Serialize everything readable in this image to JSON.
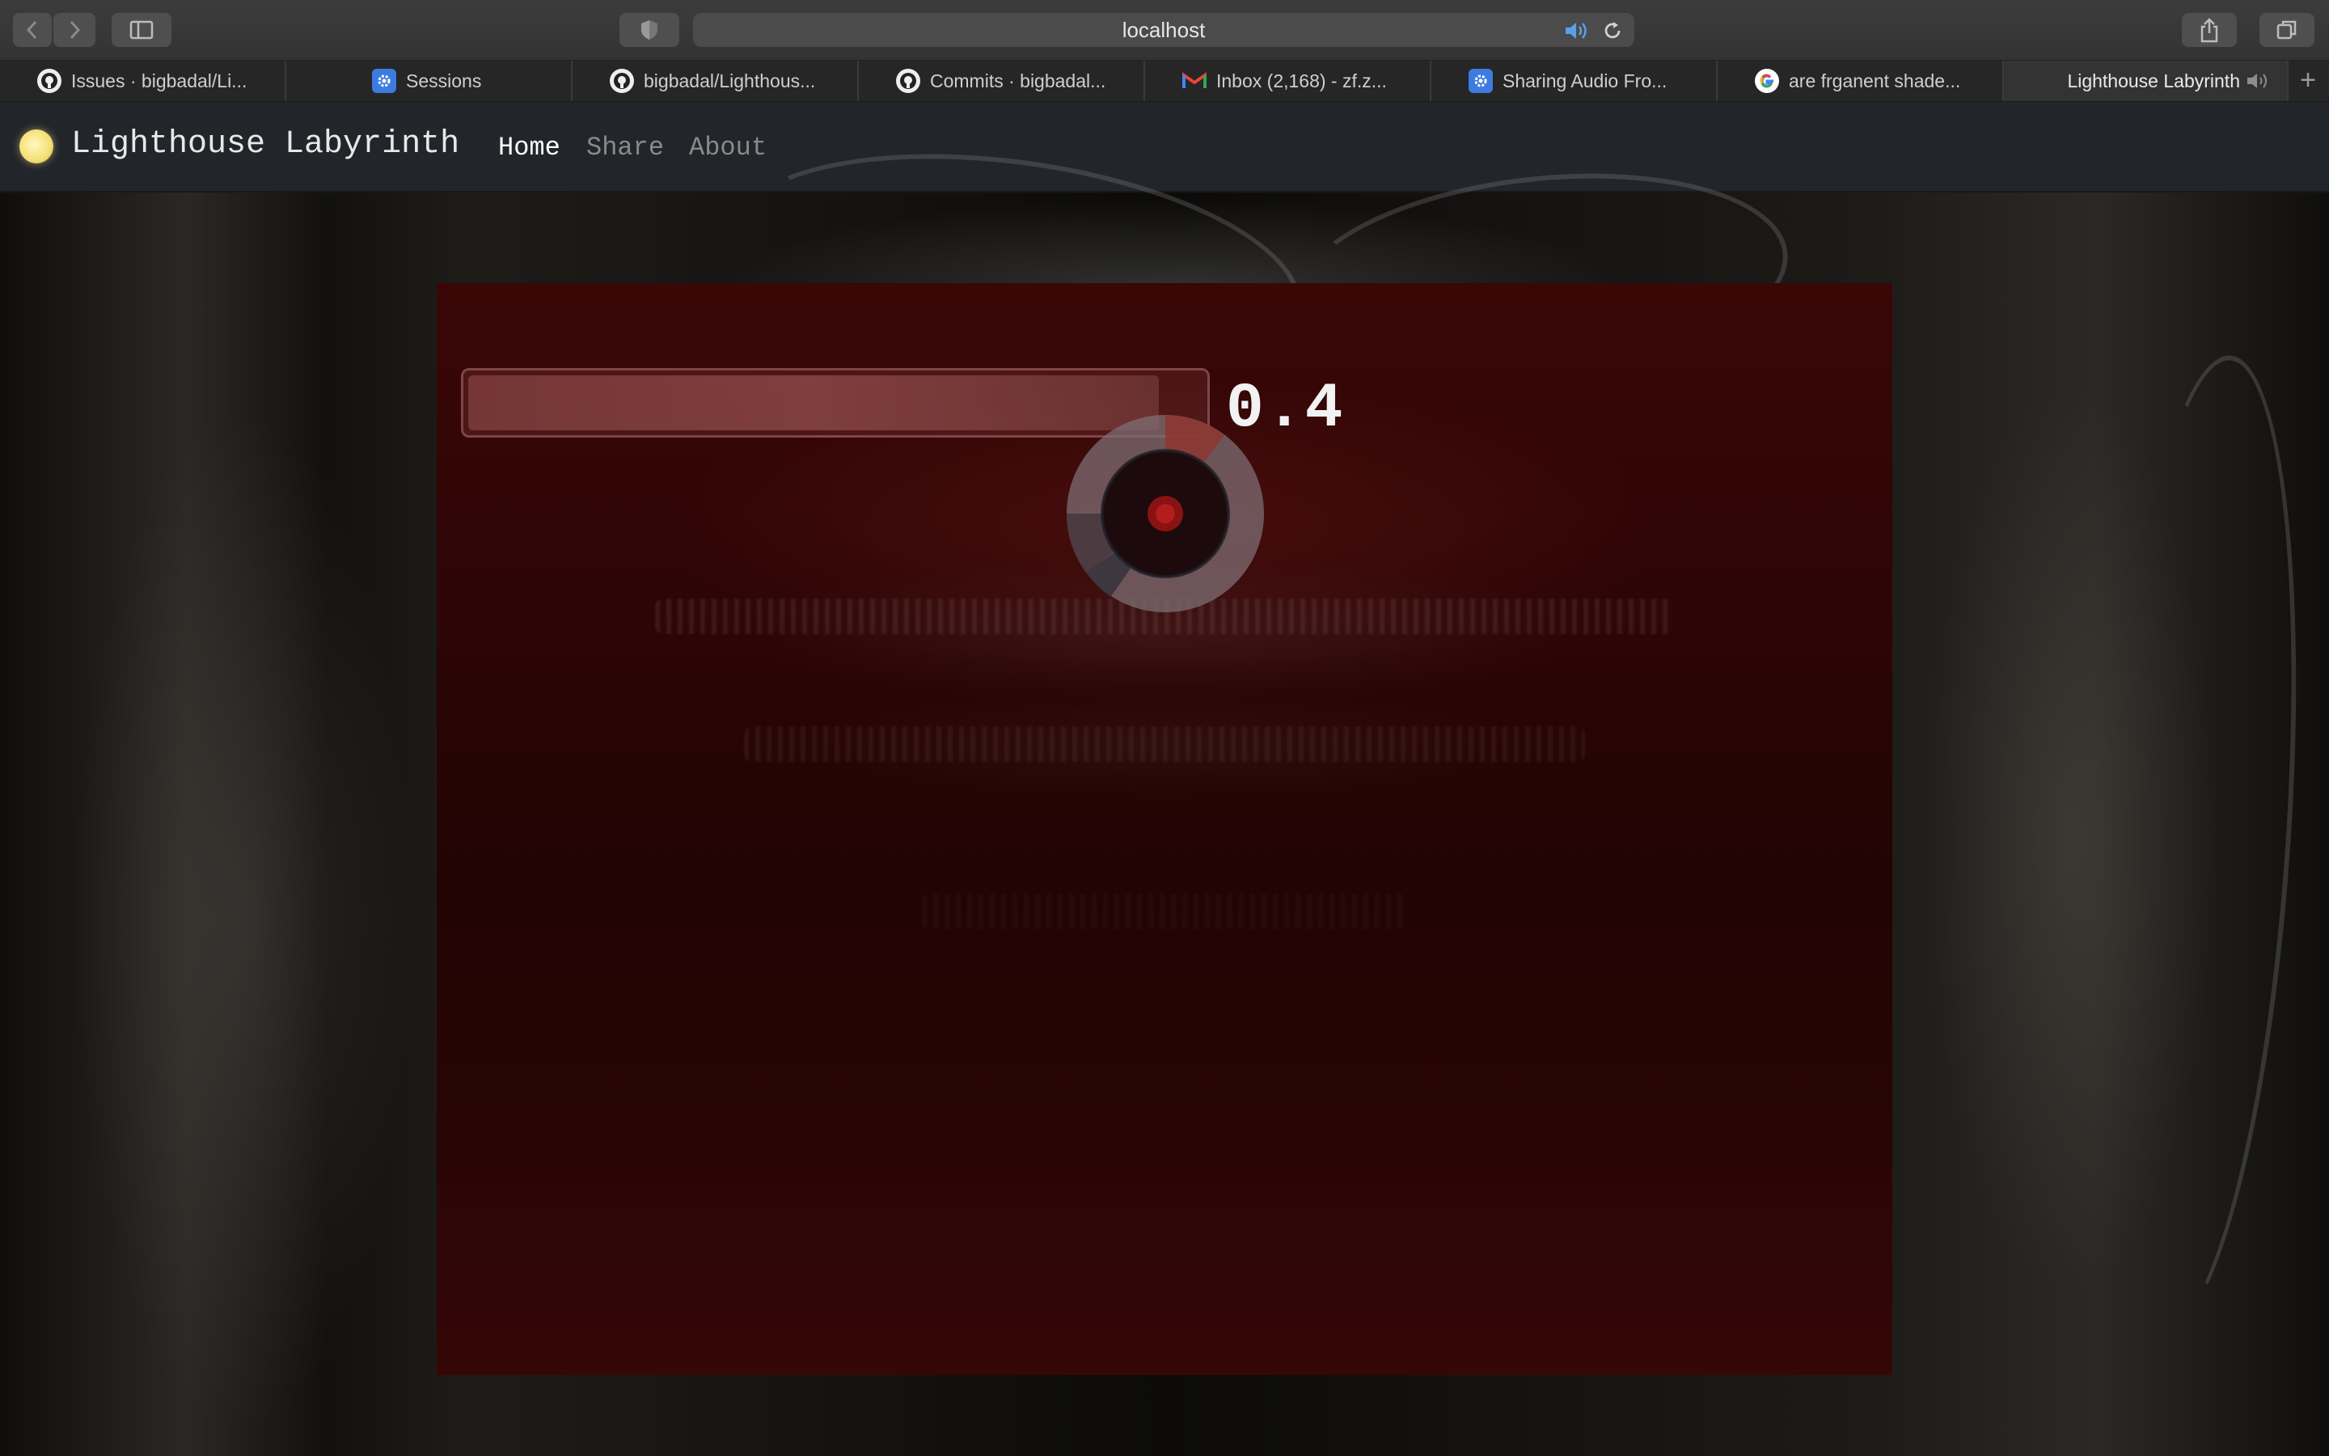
{
  "browser": {
    "url": "localhost",
    "tabs": [
      {
        "label": "Issues · bigbadal/Li...",
        "icon": "github-icon"
      },
      {
        "label": "Sessions",
        "icon": "app-gear-icon"
      },
      {
        "label": "bigbadal/Lighthous...",
        "icon": "github-icon"
      },
      {
        "label": "Commits · bigbadal...",
        "icon": "github-icon"
      },
      {
        "label": "Inbox (2,168) - zf.z...",
        "icon": "gmail-icon"
      },
      {
        "label": "Sharing Audio Fro...",
        "icon": "app-gear-icon"
      },
      {
        "label": "are frganent shade...",
        "icon": "google-icon"
      },
      {
        "label": "Lighthouse Labyrinth",
        "icon": "audio-icon",
        "active": true
      }
    ],
    "new_tab": "+"
  },
  "site": {
    "title": "Lighthouse Labyrinth",
    "nav": [
      {
        "label": "Home",
        "current": true
      },
      {
        "label": "Share",
        "current": false
      },
      {
        "label": "About",
        "current": false
      }
    ]
  },
  "game": {
    "hud_value": "0.4",
    "progress_fraction": 0.94
  },
  "colors": {
    "logo": "#f6e27a",
    "canvas": "#2d0505",
    "chrome": "#3c3c3c"
  }
}
